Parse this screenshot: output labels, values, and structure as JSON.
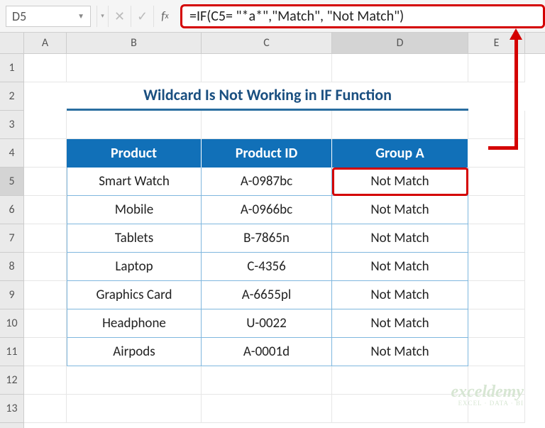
{
  "nameBox": "D5",
  "formula": "=IF(C5= \"*a*\",\"Match\", \"Not Match\")",
  "colLabels": {
    "A": "A",
    "B": "B",
    "C": "C",
    "D": "D",
    "E": "E"
  },
  "rowLabels": [
    "1",
    "2",
    "3",
    "4",
    "5",
    "6",
    "7",
    "8",
    "9",
    "10",
    "11",
    "12",
    "13"
  ],
  "title": "Wildcard Is Not Working in IF Function",
  "headers": {
    "product": "Product",
    "productId": "Product ID",
    "groupA": "Group A"
  },
  "rows": [
    {
      "product": "Smart Watch",
      "productId": "A-0987bc",
      "groupA": "Not Match"
    },
    {
      "product": "Mobile",
      "productId": "A-0966bc",
      "groupA": "Not Match"
    },
    {
      "product": "Tablets",
      "productId": "B-7865n",
      "groupA": "Not Match"
    },
    {
      "product": "Laptop",
      "productId": "C-4356",
      "groupA": "Not Match"
    },
    {
      "product": "Graphics Card",
      "productId": "A-6655pl",
      "groupA": "Not Match"
    },
    {
      "product": "Headphone",
      "productId": "U-0022",
      "groupA": "Not Match"
    },
    {
      "product": "Airpods",
      "productId": "A-0001d",
      "groupA": "Not Match"
    }
  ],
  "watermark": {
    "name": "exceldemy",
    "tag": "EXCEL · DATA · BI"
  },
  "chart_data": {
    "type": "table",
    "title": "Wildcard Is Not Working in IF Function",
    "columns": [
      "Product",
      "Product ID",
      "Group A"
    ],
    "rows": [
      [
        "Smart Watch",
        "A-0987bc",
        "Not Match"
      ],
      [
        "Mobile",
        "A-0966bc",
        "Not Match"
      ],
      [
        "Tablets",
        "B-7865n",
        "Not Match"
      ],
      [
        "Laptop",
        "C-4356",
        "Not Match"
      ],
      [
        "Graphics Card",
        "A-6655pl",
        "Not Match"
      ],
      [
        "Headphone",
        "U-0022",
        "Not Match"
      ],
      [
        "Airpods",
        "A-0001d",
        "Not Match"
      ]
    ]
  }
}
